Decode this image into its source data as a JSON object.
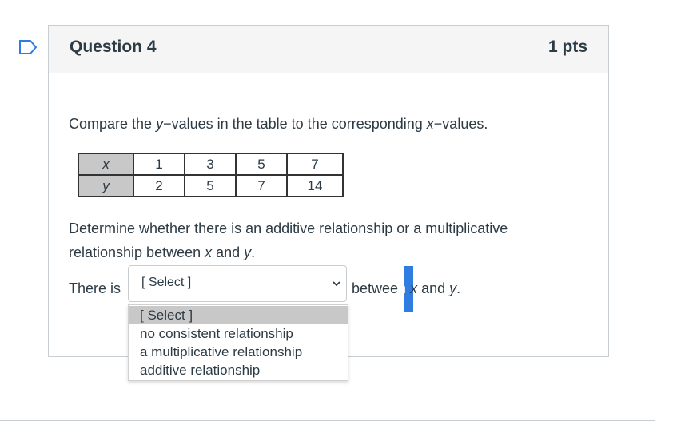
{
  "question": {
    "title": "Question 4",
    "points": "1 pts",
    "prompt_start": "Compare the ",
    "prompt_y": "y",
    "prompt_mid": "−values in the table to the corresponding ",
    "prompt_x": "x",
    "prompt_end": "−values.",
    "table": {
      "x_label": "x",
      "y_label": "y",
      "x_values": [
        "1",
        "3",
        "5",
        "7"
      ],
      "y_values": [
        "2",
        "5",
        "7",
        "14"
      ]
    },
    "determine_line1": "Determine whether there is an additive relationship or a multiplicative",
    "determine_line2_start": "relationship between ",
    "determine_x": "x",
    "determine_and": " and ",
    "determine_y": "y",
    "determine_end": ".",
    "answer_prefix": "There is",
    "answer_between_pre": "betwee",
    "answer_between_hl": "n",
    "answer_x": "x",
    "answer_and": " and ",
    "answer_y": "y",
    "answer_end": "."
  },
  "select": {
    "current_value": "[ Select ]",
    "options": [
      "[ Select ]",
      "no consistent relationship",
      "a multiplicative relationship",
      "additive relationship"
    ],
    "highlighted_index": 0
  },
  "icons": {
    "flag": "bookmark-flag-icon",
    "chevron": "chevron-down-icon"
  },
  "colors": {
    "accent": "#2f7de1",
    "text": "#2d3b45",
    "header_bg": "#f5f5f5",
    "border": "#c7cdd1",
    "table_header_bg": "#c8c8c8"
  }
}
